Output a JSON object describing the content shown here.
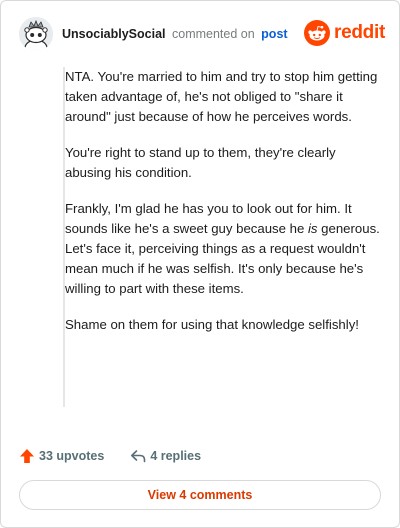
{
  "comment": {
    "username": "UnsociablySocial",
    "commented_text": "commented on",
    "post_link": "post",
    "paragraph_1": "NTA. You're married to him and try to stop him getting taken advantage of, he's not obliged to \"share it around\" just because of how he perceives words.",
    "paragraph_2": "You're right to stand up to them, they're clearly abusing his condition.",
    "paragraph_3_before": "Frankly, I'm glad he has you to look out for him. It sounds like he's a sweet guy because he ",
    "paragraph_3_em": "is",
    "paragraph_3_after": " generous. Let's face it, perceiving things as a request wouldn't mean much if he was selfish. It's only because he's willing to part with these items.",
    "paragraph_4": "Shame on them for using that knowledge selfishly!"
  },
  "brand": {
    "wordmark": "reddit",
    "color": "#ff4500",
    "icon": "reddit-snoo-icon"
  },
  "actions": {
    "upvotes_label": "33 upvotes",
    "replies_label": "4 replies",
    "upvote_icon": "upvote-arrow-icon",
    "reply_icon": "reply-arrow-icon",
    "upvote_color": "#ff4500"
  },
  "footer": {
    "view_comments_label": "View 4 comments"
  }
}
